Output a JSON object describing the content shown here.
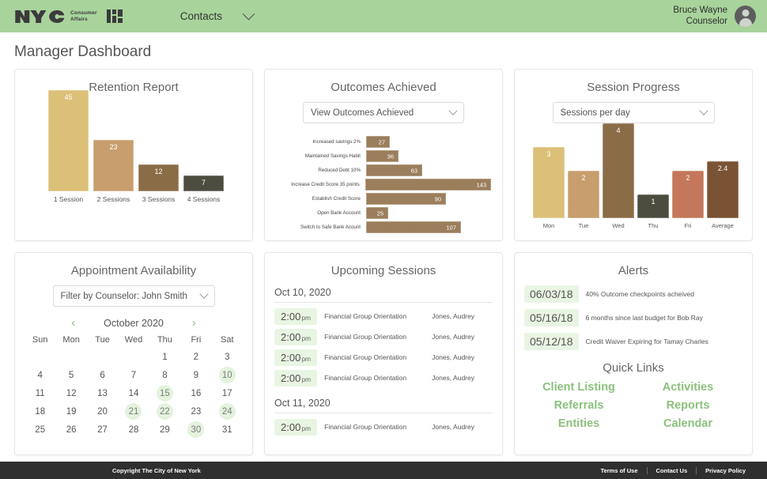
{
  "header": {
    "logo_text": "NYC",
    "agency_line1": "Consumer",
    "agency_line2": "Affairs",
    "nav": {
      "contacts": "Contacts"
    },
    "user": {
      "name": "Bruce Wayne",
      "role": "Counselor"
    }
  },
  "page": {
    "title": "Manager Dashboard"
  },
  "retention": {
    "title": "Retention Report"
  },
  "outcomes": {
    "title": "Outcomes Achieved",
    "select_value": "View Outcomes Achieved"
  },
  "session_progress": {
    "title": "Session Progress",
    "select_value": "Sessions per day"
  },
  "appointments": {
    "title": "Appointment Availability",
    "filter_value": "Filter by Counselor: John Smith",
    "month": "October 2020",
    "prev": "‹",
    "next": "›",
    "dow": [
      "Sun",
      "Mon",
      "Tue",
      "Wed",
      "Thu",
      "Fri",
      "Sat"
    ],
    "lead_blanks": 4,
    "days": [
      1,
      2,
      3,
      4,
      5,
      6,
      7,
      8,
      9,
      10,
      11,
      12,
      13,
      14,
      15,
      16,
      17,
      18,
      19,
      20,
      21,
      22,
      23,
      24,
      25,
      26,
      27,
      28,
      29,
      30,
      31
    ],
    "highlighted": [
      10,
      15,
      21,
      22,
      24,
      30
    ]
  },
  "upcoming": {
    "title": "Upcoming Sessions",
    "groups": [
      {
        "date": "Oct 10, 2020",
        "rows": [
          {
            "time": "2:00",
            "meridiem": "pm",
            "name": "Financial Group Orientation",
            "who": "Jones, Audrey"
          },
          {
            "time": "2:00",
            "meridiem": "pm",
            "name": "Financial Group Orientation",
            "who": "Jones, Audrey"
          },
          {
            "time": "2:00",
            "meridiem": "pm",
            "name": "Financial Group Orientation",
            "who": "Jones, Audrey"
          },
          {
            "time": "2:00",
            "meridiem": "pm",
            "name": "Financial Group Orientation",
            "who": "Jones, Audrey"
          }
        ]
      },
      {
        "date": "Oct 11, 2020",
        "rows": [
          {
            "time": "2:00",
            "meridiem": "pm",
            "name": "Financial Group Orientation",
            "who": "Jones, Audrey"
          }
        ]
      }
    ]
  },
  "alerts": {
    "title": "Alerts",
    "items": [
      {
        "date": "06/03/18",
        "text": "40% Outcome checkpoints acheived"
      },
      {
        "date": "05/16/18",
        "text": "6 months since last budget for Bob Ray"
      },
      {
        "date": "05/12/18",
        "text": "Credit Waiver Expiring for Tamay Charles"
      }
    ]
  },
  "quick_links": {
    "title": "Quick Links",
    "links": [
      "Client Listing",
      "Activities",
      "Referrals",
      "Reports",
      "Entities",
      "Calendar"
    ]
  },
  "footer": {
    "copyright": "Copyright The City of New York",
    "links": [
      "Terms of Use",
      "Contact Us",
      "Privacy Policy"
    ]
  },
  "colors": {
    "header_green": "#a8d39b",
    "link_green": "#8cc07e",
    "chip_green": "#e8f5e2",
    "bar_khaki": "#dcc078",
    "bar_tan": "#c79e6c",
    "bar_brown": "#8a6c46",
    "bar_olive": "#4c4c3f",
    "bar_terracotta": "#c4775a",
    "bar_darkbrown": "#7a5334",
    "outcome_bar": "#9b7e5c",
    "footer_dark": "#2f2f2f"
  },
  "chart_data": [
    {
      "type": "bar",
      "title": "Retention Report",
      "orientation": "vertical",
      "categories": [
        "1 Session",
        "2 Sessions",
        "3 Sessions",
        "4 Sessions"
      ],
      "values": [
        45,
        23,
        12,
        7
      ],
      "colors": [
        "#dcc078",
        "#c79e6c",
        "#8a6c46",
        "#4c4c3f"
      ],
      "xlabel": "",
      "ylabel": "",
      "ylim": [
        0,
        45
      ],
      "grid": false,
      "legend": false
    },
    {
      "type": "bar",
      "title": "Outcomes Achieved",
      "orientation": "horizontal",
      "categories": [
        "Increased savings 2%",
        "Maintained Savings Habit",
        "Reduced Debt 10%",
        "Increase Credit Score 35 points",
        "Establish Credit Score",
        "Open Bank Account",
        "Switch to Safe Bank Acount"
      ],
      "values": [
        27,
        36,
        63,
        143,
        90,
        25,
        107
      ],
      "color": "#9b7e5c",
      "xlabel": "",
      "ylabel": "",
      "xlim": [
        0,
        143
      ],
      "grid": false,
      "legend": false
    },
    {
      "type": "bar",
      "title": "Session Progress",
      "orientation": "vertical",
      "categories": [
        "Mon",
        "Tue",
        "Wed",
        "Thu",
        "Fri",
        "Average"
      ],
      "values": [
        3,
        2,
        4,
        1,
        2,
        2.4
      ],
      "colors": [
        "#dcc078",
        "#c79e6c",
        "#8a6c46",
        "#4c4c3f",
        "#c4775a",
        "#7a5334"
      ],
      "xlabel": "",
      "ylabel": "",
      "ylim": [
        0,
        4
      ],
      "grid": false,
      "legend": false
    }
  ]
}
